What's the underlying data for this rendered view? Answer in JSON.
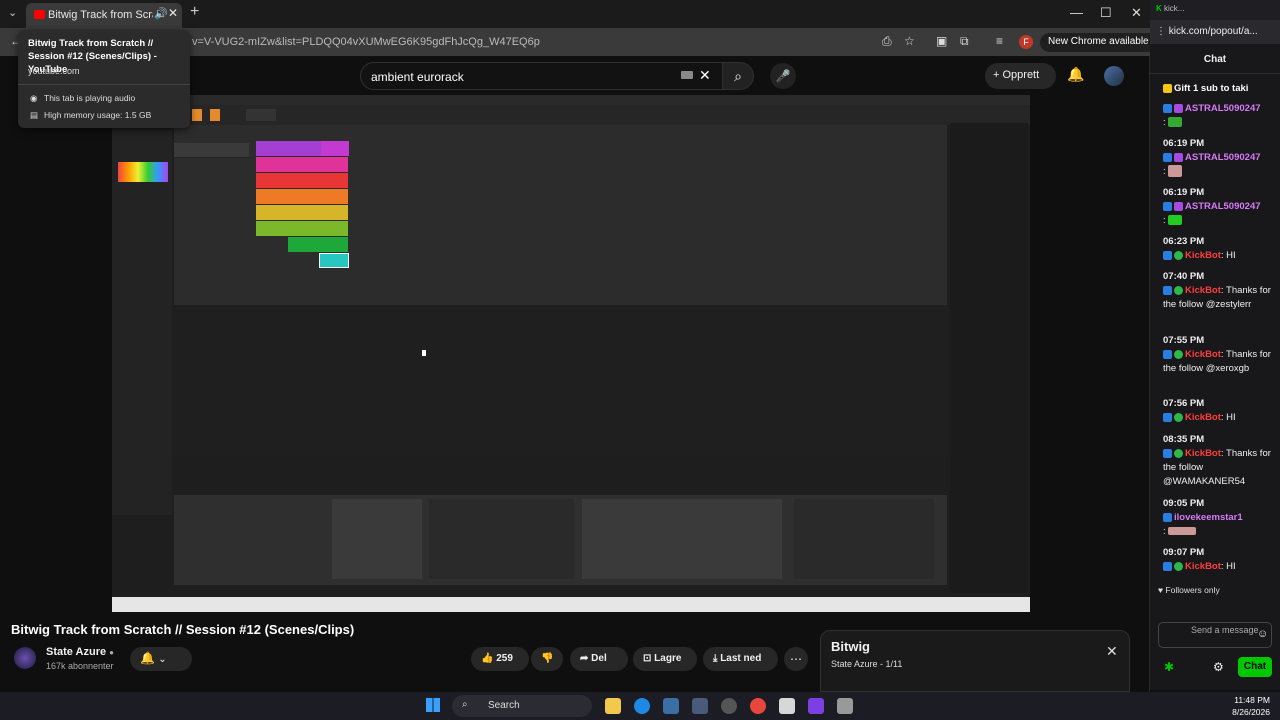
{
  "browser": {
    "tab_title": "Bitwig Track from Scratch // ",
    "tab_hover": {
      "title": "Bitwig Track from Scratch // Session #12 (Scenes/Clips) - YouTube",
      "domain": "youtube.com",
      "audio": "This tab is playing audio",
      "memory": "High memory usage: 1.5 GB"
    },
    "url": "v=V-VUG2-mIZw&list=PLDQQ04vXUMwEG6K95gdFhJcQg_W47EQ6p",
    "new_chrome": "New Chrome available",
    "profile_letter": "F"
  },
  "youtube": {
    "search_query": "ambient eurorack",
    "create_label": "Opprett",
    "video_title": "Bitwig Track from Scratch // Session #12 (Scenes/Clips)",
    "channel_name": "State Azure",
    "subscribers": "167k abonnenter",
    "likes": "259",
    "share_label": "Del",
    "save_label": "Lagre",
    "download_label": "Last ned",
    "playlist_title": "Bitwig",
    "playlist_sub": "State Azure - 1/11"
  },
  "chat": {
    "window_title": "kick...",
    "url": "kick.com/popout/a...",
    "header": "Chat",
    "gift_text": "Gift 1 sub to taki",
    "messages": [
      {
        "time": "",
        "user": "ASTRAL5090247",
        "text": ":"
      },
      {
        "time": "06:19 PM",
        "user": "ASTRAL5090247",
        "text": ":"
      },
      {
        "time": "06:19 PM",
        "user": "ASTRAL5090247",
        "text": ":"
      },
      {
        "time": "06:23 PM",
        "user": "KickBot",
        "text": ": HI"
      },
      {
        "time": "07:40 PM",
        "user": "KickBot",
        "text": ": Thanks for the follow @zestylerr"
      },
      {
        "time": "07:55 PM",
        "user": "KickBot",
        "text": ": Thanks for the follow @xeroxgb"
      },
      {
        "time": "07:56 PM",
        "user": "KickBot",
        "text": ": HI"
      },
      {
        "time": "08:35 PM",
        "user": "KickBot",
        "text": ": Thanks for the follow @WAMAKANER54"
      },
      {
        "time": "09:05 PM",
        "user": "ilovekeemstar1",
        "text": ":"
      },
      {
        "time": "09:07 PM",
        "user": "KickBot",
        "text": ": HI"
      }
    ],
    "followers_only": "Followers only",
    "input_placeholder": "Send a message",
    "send_label": "Chat"
  },
  "taskbar": {
    "search_label": "Search",
    "time": "11:48 PM",
    "date": "8/26/2026"
  },
  "colors": {
    "accent_red": "#ff0000",
    "kick_green": "#00c800",
    "kickbot_red": "#ff3d3d",
    "user_purple": "#d77af7"
  }
}
